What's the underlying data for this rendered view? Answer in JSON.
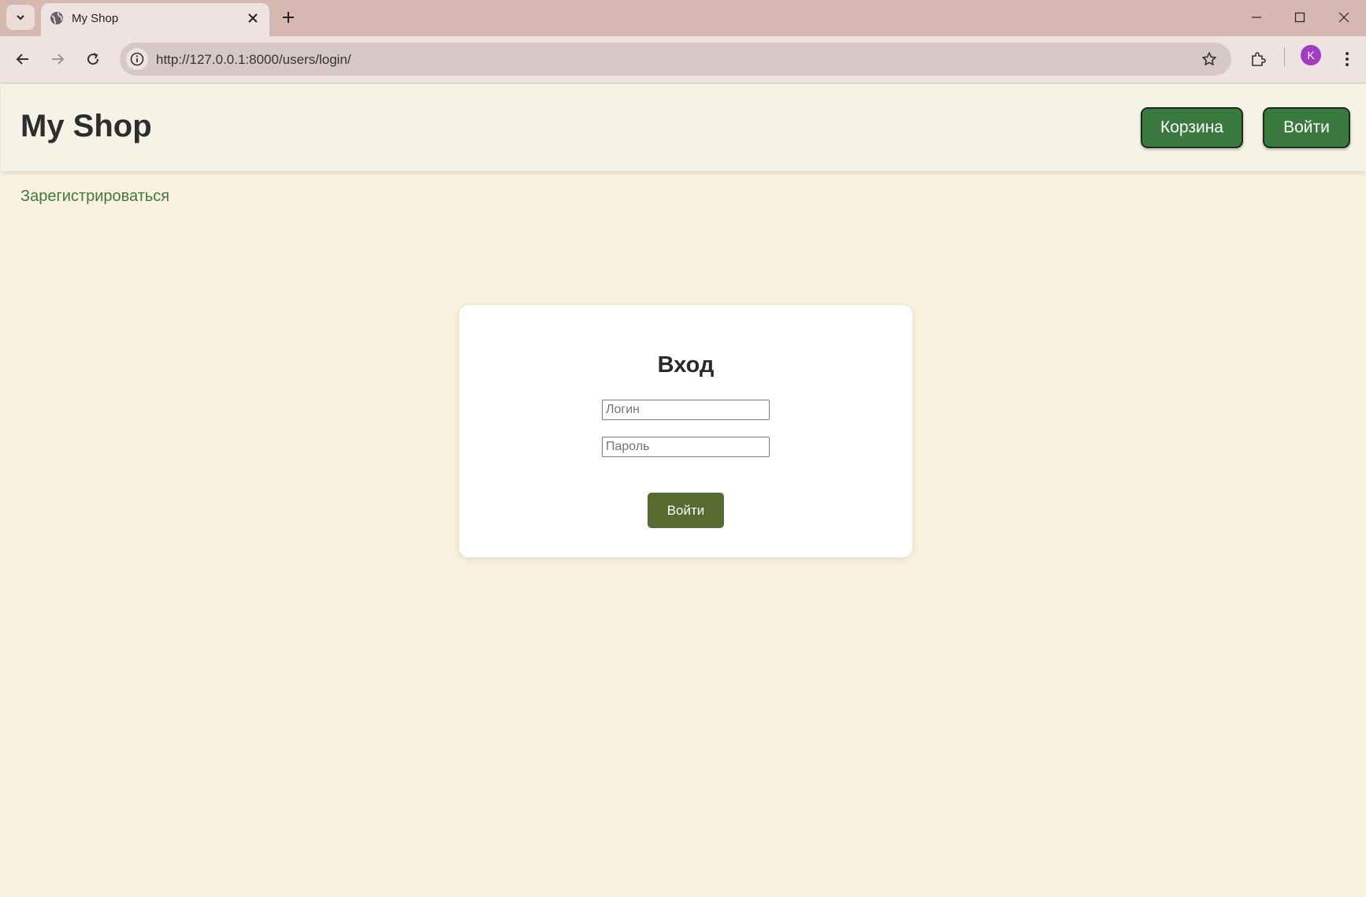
{
  "browser": {
    "tab_title": "My Shop",
    "url": "http://127.0.0.1:8000/users/login/",
    "profile_initial": "K"
  },
  "header": {
    "logo": "My Shop",
    "cart_label": "Корзина",
    "login_label": "Войти"
  },
  "register_link": "Зарегистрироваться",
  "login_form": {
    "title": "Вход",
    "username_placeholder": "Логин",
    "password_placeholder": "Пароль",
    "submit_label": "Войти"
  },
  "colors": {
    "page_background": "#faf2df",
    "header_background": "#f5f2e6",
    "header_button": "#3b7a3f",
    "submit_button": "#556b2f",
    "link": "#3d7a3f",
    "tab_strip": "#d7b8b0"
  }
}
